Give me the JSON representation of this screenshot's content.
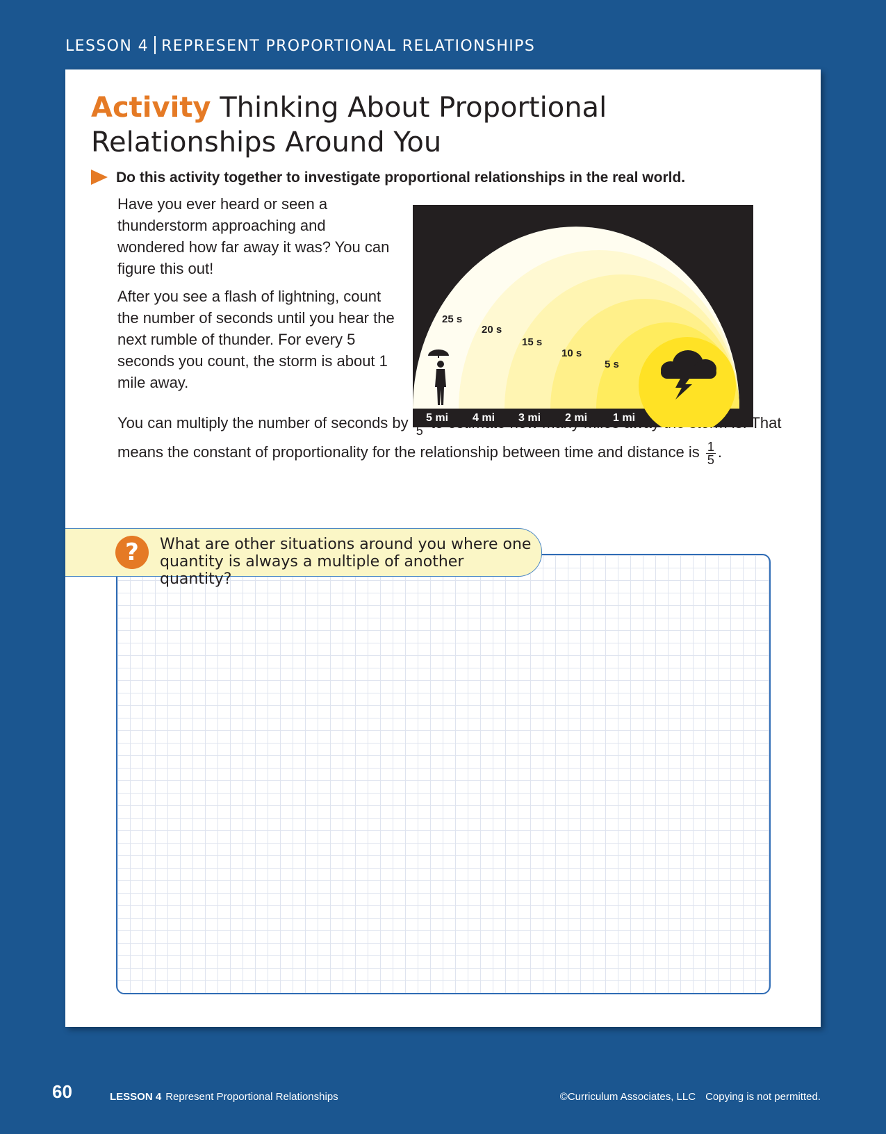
{
  "header": {
    "lesson": "LESSON 4",
    "title": "REPRESENT PROPORTIONAL RELATIONSHIPS"
  },
  "activity": {
    "tag": "Activity",
    "title": "Thinking About Proportional Relationships Around You",
    "direction": "Do this activity together to investigate proportional relationships in the real world.",
    "p1": "Have you ever heard or seen a thunderstorm approaching and wondered how far away it was? You can figure this out!",
    "p2": "After you see a flash of lightning, count the number of seconds until you hear the next rumble of thunder. For every 5 seconds you count, the storm is about 1 mile away.",
    "p3_a": "You can multiply the number of seconds by",
    "p3_b": "to estimate how many miles away the storm is. That means the constant of proportionality for the relationship between time and distance is",
    "p3_c": ".",
    "frac_num": "1",
    "frac_den": "5"
  },
  "illustration": {
    "seconds_labels": [
      "25 s",
      "20 s",
      "15 s",
      "10 s",
      "5 s"
    ],
    "mile_labels": [
      "5 mi",
      "4 mi",
      "3 mi",
      "2 mi",
      "1 mi"
    ]
  },
  "question": {
    "icon": "?",
    "text": "What are other situations around you where one quantity is always a multiple of another quantity?"
  },
  "footer": {
    "page": "60",
    "lesson_bold": "LESSON 4",
    "lesson_title": "Represent Proportional Relationships",
    "copyright": "©Curriculum Associates, LLC",
    "notice": "Copying is not permitted."
  },
  "colors": {
    "background": "#1b5690",
    "accent": "#e57a25",
    "border": "#2f6cb5"
  }
}
